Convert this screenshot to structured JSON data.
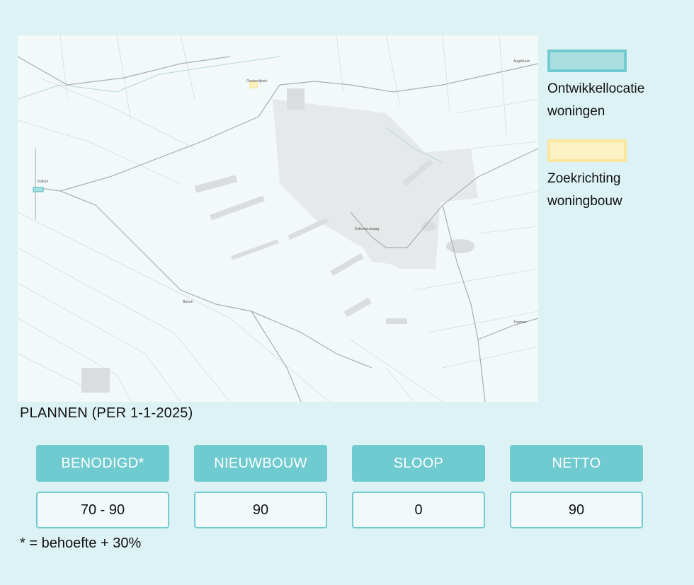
{
  "map": {
    "places": [
      "Oosternijkerk",
      "Kollum",
      "Kollumerzwaag",
      "Burum",
      "Triemen",
      "Augsbuurt"
    ]
  },
  "legend": {
    "development": "Ontwikkellocatie woningen",
    "search": "Zoekrichting woningbouw"
  },
  "plans": {
    "title": "PLANNEN (PER 1-1-2025)",
    "columns": [
      {
        "label": "BENODIGD*",
        "value": "70 - 90"
      },
      {
        "label": "NIEUWBOUW",
        "value": "90"
      },
      {
        "label": "SLOOP",
        "value": "0"
      },
      {
        "label": "NETTO",
        "value": "90"
      }
    ],
    "footnote": "* = behoefte + 30%"
  },
  "colors": {
    "accent": "#6fcbd0",
    "background": "#ddf2f4",
    "development_fill": "#a9dde0",
    "search_fill": "#fdf2c4",
    "search_border": "#fae69d"
  }
}
